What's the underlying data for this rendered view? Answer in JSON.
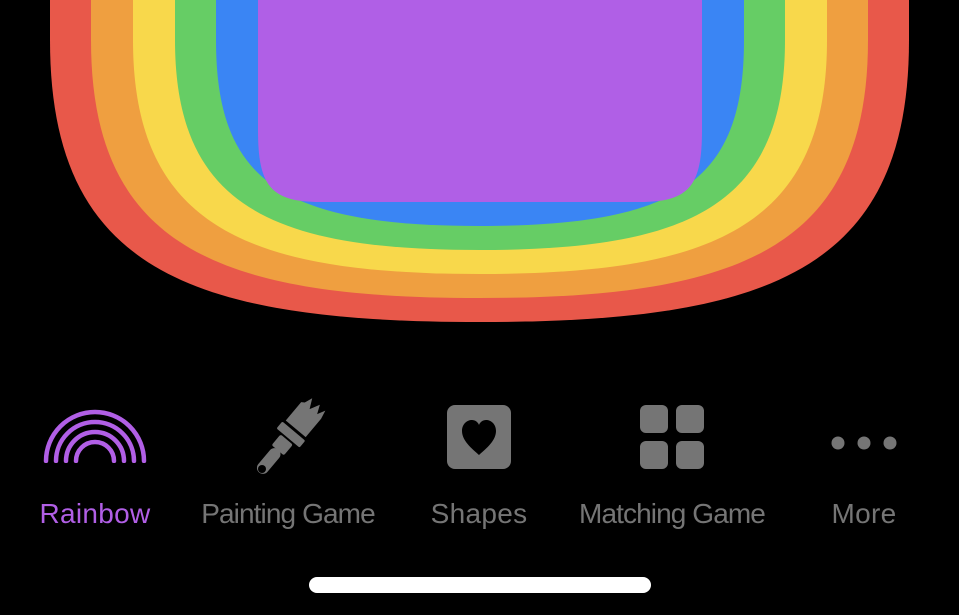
{
  "colors": {
    "background": "#000000",
    "rainbow_bands": [
      "#e8584a",
      "#ef9f40",
      "#f8d84b",
      "#66cd65",
      "#3a85f4",
      "#b05fe6"
    ],
    "active_tab": "#b15fe6",
    "inactive_tab": "#757575",
    "home_indicator": "#ffffff"
  },
  "artwork": {
    "icon": "rainbow-artwork"
  },
  "tab_bar": {
    "selected": "Rainbow",
    "tabs": [
      {
        "label": "Rainbow",
        "icon": "rainbow-icon",
        "active": true
      },
      {
        "label": "Painting Game",
        "icon": "paintbrush-icon",
        "active": false
      },
      {
        "label": "Shapes",
        "icon": "heart-square-icon",
        "active": false
      },
      {
        "label": "Matching Game",
        "icon": "grid-icon",
        "active": false
      },
      {
        "label": "More",
        "icon": "ellipsis-icon",
        "active": false
      }
    ]
  }
}
